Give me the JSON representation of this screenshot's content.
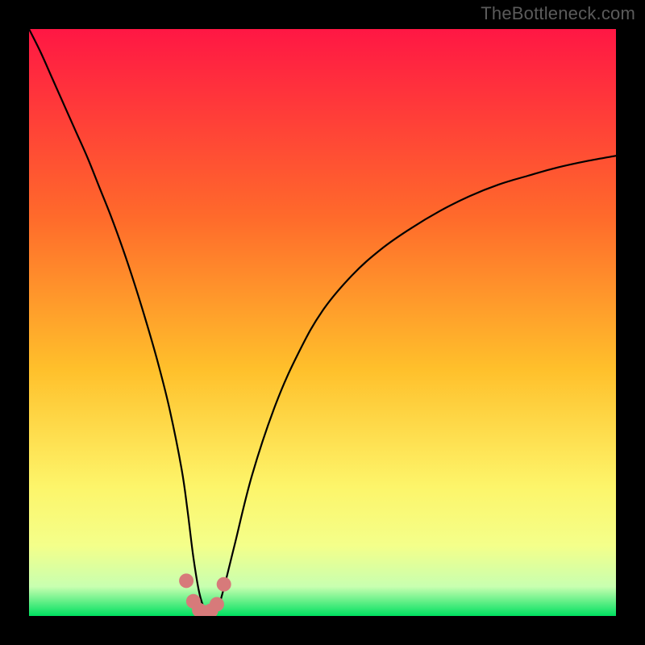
{
  "watermark": {
    "text": "TheBottleneck.com"
  },
  "colors": {
    "page_bg": "#000000",
    "curve": "#000000",
    "marker_fill": "#D77A7A",
    "marker_stroke": "#B15A5A",
    "watermark": "#5b5b5b",
    "gradient_top": "#FF1744",
    "gradient_mid1": "#FF6A2B",
    "gradient_mid2": "#FFC02B",
    "gradient_mid3": "#FDF56A",
    "gradient_band": "#F4FF8A",
    "gradient_pale": "#C8FFB0",
    "gradient_bottom": "#00E060"
  },
  "chart_data": {
    "type": "line",
    "title": "",
    "xlabel": "",
    "ylabel": "",
    "xlim": [
      0,
      100
    ],
    "ylim": [
      0,
      100
    ],
    "grid": false,
    "legend": false,
    "x": [
      0,
      2,
      4,
      6,
      8,
      10,
      12,
      14,
      16,
      18,
      20,
      22,
      24,
      26,
      27,
      28,
      29,
      30,
      31,
      32,
      33,
      35,
      38,
      42,
      46,
      50,
      55,
      60,
      65,
      70,
      75,
      80,
      85,
      90,
      95,
      100
    ],
    "values": [
      100,
      96,
      91.5,
      87,
      82.5,
      78,
      73,
      68,
      62.5,
      56.5,
      50,
      43,
      35,
      25,
      18,
      10,
      4,
      1,
      0.5,
      1,
      4,
      12,
      24,
      36,
      45,
      52,
      58,
      62.5,
      66,
      69,
      71.5,
      73.5,
      75,
      76.4,
      77.5,
      78.4
    ],
    "markers": {
      "x": [
        26.8,
        28.0,
        29.0,
        30.0,
        31.0,
        32.0,
        33.2
      ],
      "y": [
        6.0,
        2.5,
        1.0,
        0.6,
        0.9,
        2.0,
        5.4
      ]
    }
  }
}
